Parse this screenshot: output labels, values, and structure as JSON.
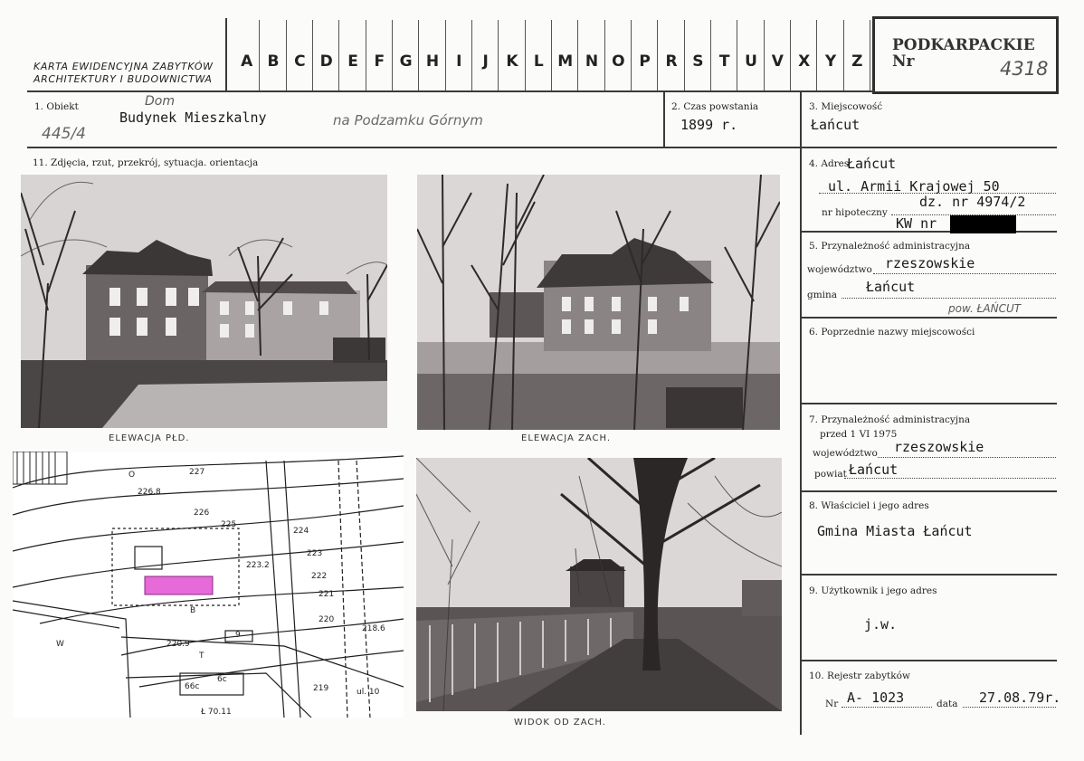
{
  "header": {
    "card_title_line1": "KARTA EWIDENCYJNA ZABYTKÓW",
    "card_title_line2": "ARCHITEKTURY I BUDOWNICTWA",
    "alphabet": [
      "A",
      "B",
      "C",
      "D",
      "E",
      "F",
      "G",
      "H",
      "I",
      "J",
      "K",
      "L",
      "M",
      "N",
      "O",
      "P",
      "R",
      "S",
      "T",
      "U",
      "V",
      "X",
      "Y",
      "Z"
    ],
    "region": "PODKARPACKIE",
    "nr_label": "Nr",
    "nr_value": "4318"
  },
  "obiekt": {
    "label": "1. Obiekt",
    "value": "Budynek Mieszkalny",
    "handwritten_above": "Dom",
    "handwritten_after": "na Podzamku Górnym",
    "handwritten_ref": "445/4"
  },
  "czas": {
    "label": "2. Czas powstania",
    "value": "1899 r."
  },
  "miejscowosc": {
    "label": "3. Miejscowość",
    "value": "Łańcut"
  },
  "photos_section": {
    "label": "11. Zdjęcia, rzut, przekrój, sytuacja. orientacja",
    "captions": [
      "ELEWACJA PŁD.",
      "ELEWACJA ZACH.",
      "WIDOK OD ZACH."
    ]
  },
  "map": {
    "labels": [
      "226.8",
      "227",
      "226",
      "225",
      "224",
      "223",
      "222",
      "221",
      "220",
      "223.2",
      "218.6",
      "220.9",
      "219",
      "O",
      "W",
      "B",
      "T",
      "ul. 10",
      "6c",
      "66c",
      "Ł 70.11",
      "9"
    ]
  },
  "adres": {
    "label": "4. Adres",
    "city": "Łańcut",
    "street": "ul. Armii Krajowej 50",
    "plot": "dz. nr 4974/2",
    "hipoteczny_label": "nr hipoteczny",
    "kw_label": "KW nr"
  },
  "przynaleznosc": {
    "label": "5. Przynależność administracyjna",
    "woj_label": "województwo",
    "woj_value": "rzeszowskie",
    "gmina_label": "gmina",
    "gmina_value": "Łańcut",
    "handwritten_pow": "pow. ŁAŃCUT"
  },
  "poprzednie": {
    "label": "6. Poprzednie nazwy miejscowości"
  },
  "przynaleznosc1975": {
    "label": "7. Przynależność administracyjna",
    "sub": "przed 1 VI 1975",
    "woj_label": "województwo",
    "woj_value": "rzeszowskie",
    "powiat_label": "powiat",
    "powiat_value": "Łańcut"
  },
  "wlasciciel": {
    "label": "8. Właściciel i jego adres",
    "value": "Gmina Miasta Łańcut"
  },
  "uzytkownik": {
    "label": "9. Użytkownik i jego adres",
    "value": "j.w."
  },
  "rejestr": {
    "label": "10. Rejestr zabytków",
    "nr_label": "Nr",
    "nr_value": "A- 1023",
    "data_label": "data",
    "data_value": "27.08.79r."
  }
}
